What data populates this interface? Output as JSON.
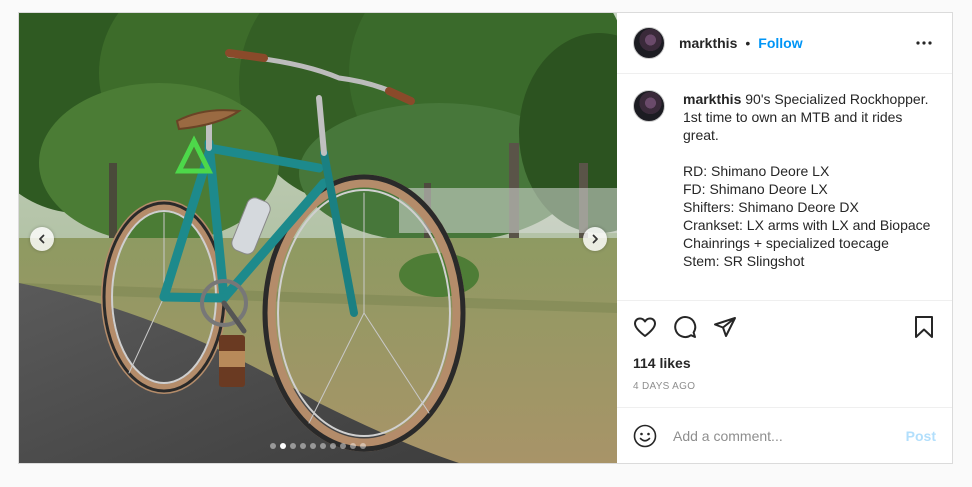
{
  "post": {
    "author": "markthis",
    "separator": "•",
    "follow_label": "Follow",
    "more_icon": "more-horizontal-icon",
    "caption_user": "markthis",
    "caption_text": " 90's Specialized Rockhopper.\n1st time to own an MTB and it rides great.\n\nRD: Shimano Deore LX\nFD: Shimano Deore LX\nShifters: Shimano Deore DX\nCrankset: LX arms with LX and Biopace Chainrings + specialized toecage\nStem: SR Slingshot",
    "likes": "114 likes",
    "time": "4 DAYS AGO"
  },
  "media": {
    "slide_count": 10,
    "active_slide": 2,
    "prev_icon": "chevron-left-icon",
    "next_icon": "chevron-right-icon"
  },
  "comment": {
    "placeholder": "Add a comment...",
    "post_label": "Post",
    "emoji_icon": "smiley-icon"
  },
  "colors": {
    "accent": "#0095f6",
    "post_disabled": "#b2dffc",
    "muted": "#8e8e8e"
  }
}
